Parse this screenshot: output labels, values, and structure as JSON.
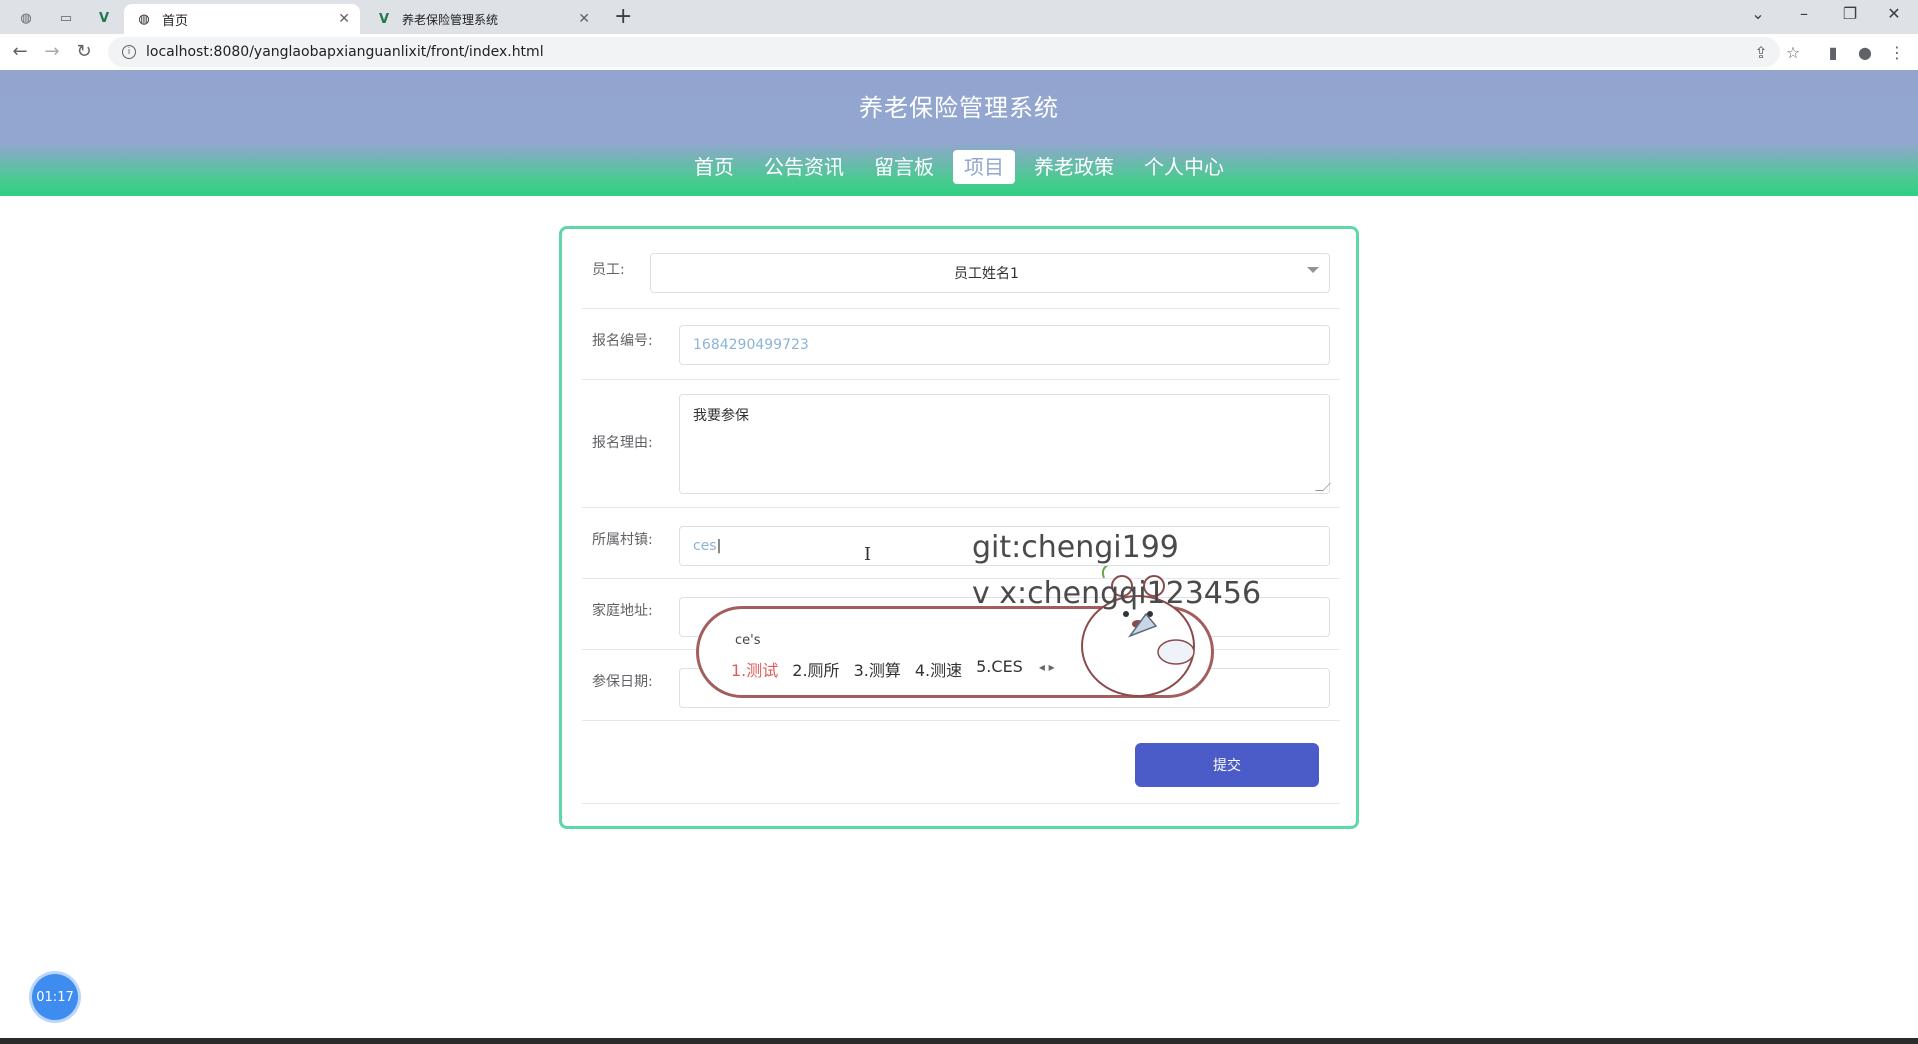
{
  "browser": {
    "tabs": [
      {
        "title": "首页",
        "icon": "globe-icon",
        "active": true
      },
      {
        "title": "养老保险管理系统",
        "icon": "vue-logo-icon",
        "active": false
      }
    ],
    "address": "localhost:8080/yanglaobapxianguanlixit/front/index.html"
  },
  "site": {
    "title": "养老保险管理系统",
    "nav": [
      "首页",
      "公告资讯",
      "留言板",
      "项目",
      "养老政策",
      "个人中心"
    ],
    "nav_active": "项目"
  },
  "form": {
    "employee": {
      "label": "员工:",
      "value": "员工姓名1"
    },
    "reg_no": {
      "label": "报名编号:",
      "value": "1684290499723"
    },
    "reason": {
      "label": "报名理由:",
      "value": "我要参保"
    },
    "village": {
      "label": "所属村镇:",
      "value": "ces"
    },
    "address": {
      "label": "家庭地址:",
      "value": ""
    },
    "date": {
      "label": "参保日期:",
      "value": ""
    },
    "submit_label": "提交"
  },
  "ime": {
    "composing": "ce's",
    "candidates": [
      "1.测试",
      "2.厕所",
      "3.测算",
      "4.测速",
      "5.CES"
    ]
  },
  "watermark": {
    "line1": "git:chengi199",
    "line2": "v x:chengqi123456"
  },
  "timer": "01:17",
  "colors": {
    "header_top": "#93a5cf",
    "header_bottom": "#2fcf83",
    "card_border": "#5fd8a8",
    "submit": "#4b5bc7",
    "timer": "#3f8cf0"
  }
}
